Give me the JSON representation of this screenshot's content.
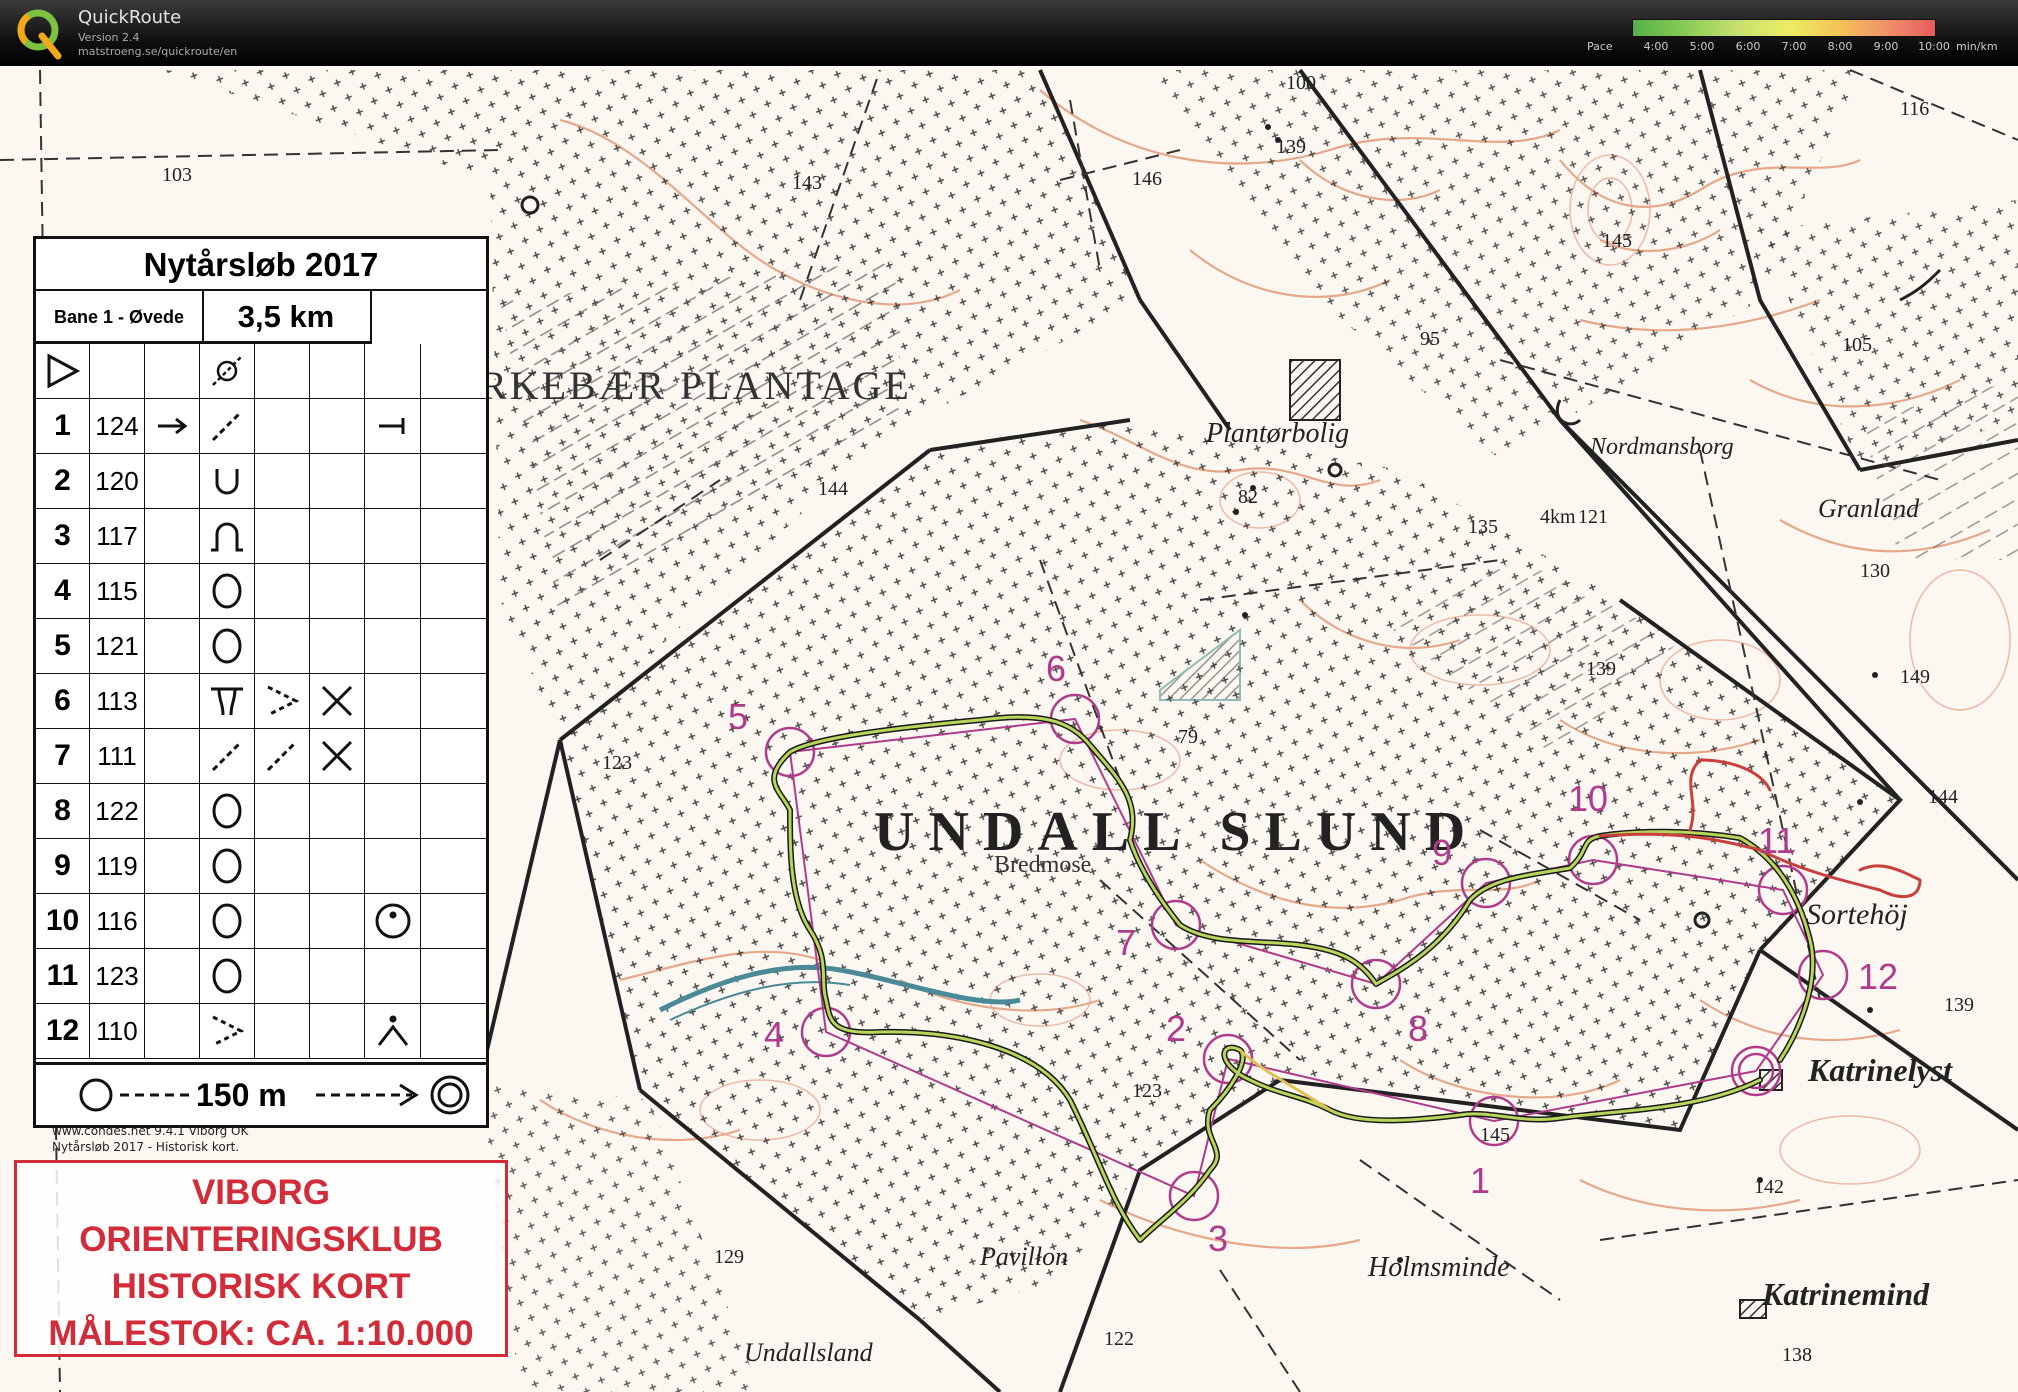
{
  "app": {
    "name": "QuickRoute",
    "version": "Version 2.4",
    "url": "matstroeng.se/quickroute/en"
  },
  "pace_legend": {
    "label": "Pace",
    "ticks": [
      "4:00",
      "5:00",
      "6:00",
      "7:00",
      "8:00",
      "9:00",
      "10:00"
    ],
    "unit": "min/km"
  },
  "control_card": {
    "title": "Nytårsløb 2017",
    "course": "Bane 1 - Øvede",
    "length": "3,5 km",
    "rows": [
      {
        "num": "1",
        "code": "124"
      },
      {
        "num": "2",
        "code": "120"
      },
      {
        "num": "3",
        "code": "117"
      },
      {
        "num": "4",
        "code": "115"
      },
      {
        "num": "5",
        "code": "121"
      },
      {
        "num": "6",
        "code": "113"
      },
      {
        "num": "7",
        "code": "111"
      },
      {
        "num": "8",
        "code": "122"
      },
      {
        "num": "9",
        "code": "119"
      },
      {
        "num": "10",
        "code": "116"
      },
      {
        "num": "11",
        "code": "123"
      },
      {
        "num": "12",
        "code": "110"
      }
    ],
    "finish_distance": "150 m"
  },
  "credits": {
    "line1": "www.condes.net 9.4.1 Viborg OK",
    "line2": "Nytårsløb 2017 - Historisk kort."
  },
  "stamp": {
    "line1": "VIBORG",
    "line2": "ORIENTERINGSKLUB",
    "line3": "HISTORISK KORT",
    "line4": "MÅLESTOK: CA. 1:10.000"
  },
  "map_labels": {
    "plantage": "RKEBÆR  PLANTAGE",
    "undall": "UNDALL SLUND",
    "bredmose": "Bredmose",
    "plantorbolig": "Plantørbolig",
    "nordmann": "Nordman",
    "nordmannsborg": "Nordmansborg",
    "granland": "Granland",
    "sortehoj": "Sortehöj",
    "katrinelyst": "Katrinelyst",
    "holmsminde": "Holmsminde",
    "katrinemind": "Katrinemind",
    "pavillon": "Pavillon",
    "undallsland": "Undallsland",
    "elev_103": "103",
    "elev_143": "143",
    "elev_146": "146",
    "elev_139a": "139",
    "elev_145": "145",
    "elev_95": "95",
    "elev_105": "105",
    "elev_116": "116",
    "elev_144": "144",
    "elev_82": "82",
    "elev_135": "135",
    "elev_121": "121",
    "elev_130": "130",
    "elev_149": "149",
    "elev_139b": "139",
    "elev_123a": "123",
    "elev_79": "79",
    "elev_144b": "144",
    "elev_139c": "139",
    "elev_142": "142",
    "elev_123b": "123",
    "elev_145b": "145",
    "elev_129": "129",
    "elev_122": "122",
    "elev_138": "138",
    "elev_100": "100",
    "elev_4km": "4km"
  },
  "controls": [
    {
      "label": "1"
    },
    {
      "label": "2"
    },
    {
      "label": "3"
    },
    {
      "label": "4"
    },
    {
      "label": "5"
    },
    {
      "label": "6"
    },
    {
      "label": "7"
    },
    {
      "label": "8"
    },
    {
      "label": "9"
    },
    {
      "label": "10"
    },
    {
      "label": "11"
    },
    {
      "label": "12"
    }
  ],
  "colors": {
    "course": "#b03a8c",
    "contour": "#e08a63",
    "stamp": "#d22b3a",
    "route_fast": "#55b04a",
    "route_slow": "#d94f4f"
  }
}
